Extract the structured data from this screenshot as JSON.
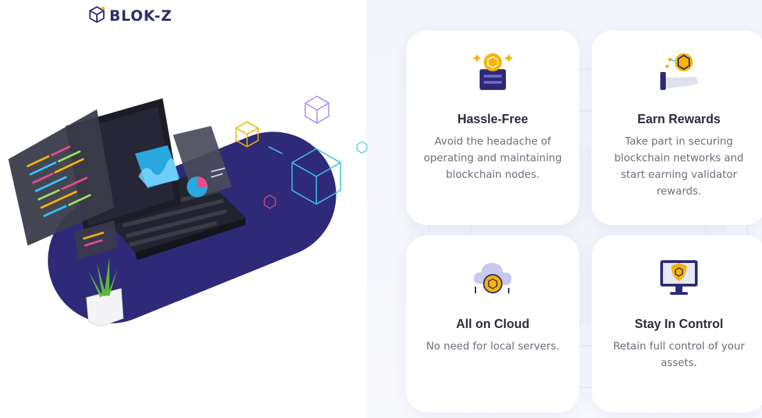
{
  "brand": {
    "name": "BLOK-Z",
    "logo_icon": "cube-icon",
    "colors": {
      "primary": "#2c2f6e",
      "accent": "#f5b400",
      "navy": "#2f2a78"
    }
  },
  "features": [
    {
      "title": "Hassle-Free",
      "description": "Avoid the headache of operating and maintaining blockchain nodes.",
      "icon": "server-coin-icon"
    },
    {
      "title": "Earn Rewards",
      "description": "Take part in securing blockchain networks and start earning validator rewards.",
      "icon": "hand-coin-icon"
    },
    {
      "title": "All on Cloud",
      "description": "No need for local servers.",
      "icon": "cloud-coin-icon"
    },
    {
      "title": "Stay In Control",
      "description": "Retain full control of your assets.",
      "icon": "monitor-shield-icon"
    }
  ]
}
